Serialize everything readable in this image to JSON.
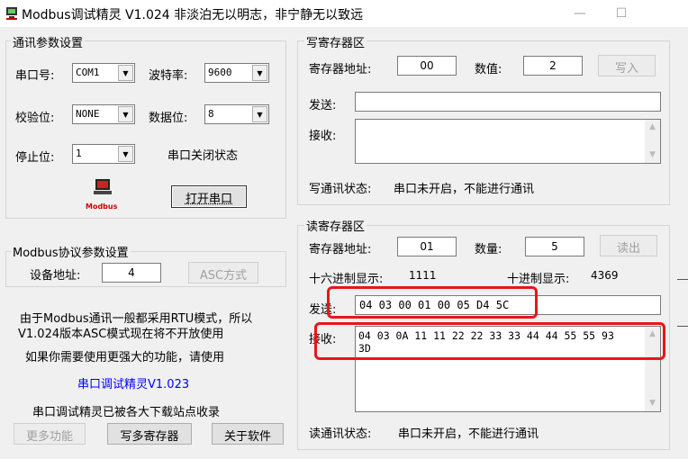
{
  "window": {
    "title": "Modbus调试精灵 V1.024    非淡泊无以明志，非宁静无以致远",
    "icons": {
      "minimize": "minimize-icon",
      "maximize": "maximize-icon"
    }
  },
  "comm": {
    "legend": "通讯参数设置",
    "port_label": "串口号:",
    "port_value": "COM1",
    "baud_label": "波特率:",
    "baud_value": "9600",
    "parity_label": "校验位:",
    "parity_value": "NONE",
    "databits_label": "数据位:",
    "databits_value": "8",
    "stopbits_label": "停止位:",
    "stopbits_value": "1",
    "port_status": "串口关闭状态",
    "logo_text": "Modbus",
    "open_button": "打开串口"
  },
  "modbus": {
    "legend": "Modbus协议参数设置",
    "device_label": "设备地址:",
    "device_value": "4",
    "asc_button": "ASC方式"
  },
  "info": {
    "line1": "由于Modbus通讯一般都采用RTU模式，所以",
    "line2": "V1.024版本ASC模式现在将不开放使用",
    "line3": "如果你需要使用更强大的功能，请使用",
    "link": "串口调试精灵V1.023",
    "line4": "串口调试精灵已被各大下载站点收录"
  },
  "bottom_buttons": {
    "more": "更多功能",
    "write_multi": "写多寄存器",
    "about": "关于软件"
  },
  "write": {
    "legend": "写寄存器区",
    "addr_label": "寄存器地址:",
    "addr_value": "00",
    "value_label": "数值:",
    "value_value": "2",
    "write_button": "写入",
    "send_label": "发送:",
    "send_value": "",
    "recv_label": "接收:",
    "recv_value": "",
    "status_label": "写通讯状态:",
    "status_value": "串口未开启，不能进行通讯"
  },
  "read": {
    "legend": "读寄存器区",
    "addr_label": "寄存器地址:",
    "addr_value": "01",
    "qty_label": "数量:",
    "qty_value": "5",
    "read_button": "读出",
    "hex_label": "十六进制显示:",
    "hex_value": "1111",
    "dec_label": "十进制显示:",
    "dec_value": "4369",
    "send_label": "发送:",
    "send_value": "04 03 00 01 00 05 D4 5C",
    "recv_label": "接收:",
    "recv_line1": "04 03 0A 11 11 22 22 33 33 44 44 55 55 93",
    "recv_line2": "3D",
    "status_label": "读通讯状态:",
    "status_value": "串口未开启，不能进行通讯"
  },
  "colors": {
    "highlight": "#e8151b",
    "link": "#0000ff",
    "logo": "#cc0000"
  }
}
